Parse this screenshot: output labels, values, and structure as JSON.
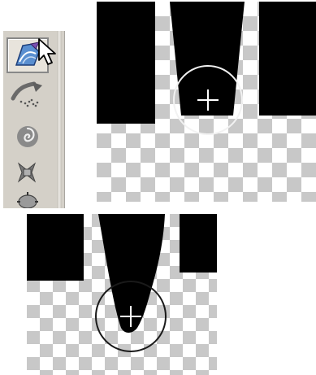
{
  "toolbar": {
    "tools": [
      {
        "icon": "liquify-warp-icon",
        "selected": true
      },
      {
        "icon": "reconstruct-brush-icon",
        "selected": false
      },
      {
        "icon": "twirl-icon",
        "selected": false
      },
      {
        "icon": "pucker-icon",
        "selected": false
      },
      {
        "icon": "bloat-icon",
        "selected": false
      }
    ],
    "cursor_icon": "arrow-pointer-icon"
  },
  "canvas": {
    "background": "transparency-checkerboard",
    "shape_color": "#000000",
    "checker_color": "#c8c8c8",
    "brush_ring_color": "#1a1a1a"
  }
}
